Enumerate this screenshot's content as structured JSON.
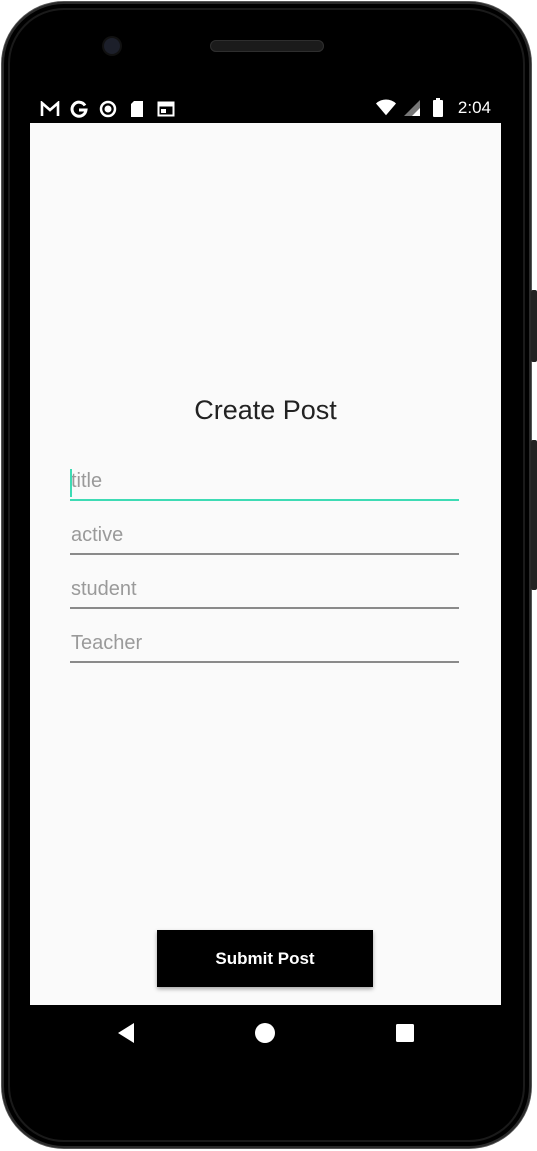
{
  "statusbar": {
    "left_icons": [
      "gmail-icon",
      "google-icon",
      "record-icon",
      "sd-card-icon",
      "calendar-icon"
    ],
    "right_icons": [
      "wifi-icon",
      "signal-icon",
      "battery-icon"
    ],
    "time": "2:04"
  },
  "main": {
    "title": "Create Post",
    "fields": [
      {
        "placeholder": "title",
        "value": "",
        "focused": true
      },
      {
        "placeholder": "active",
        "value": ""
      },
      {
        "placeholder": "student",
        "value": ""
      },
      {
        "placeholder": "Teacher",
        "value": ""
      }
    ],
    "submit_label": "Submit Post"
  },
  "navbar": {
    "icons": [
      "back-icon",
      "home-icon",
      "recents-icon"
    ]
  },
  "colors": {
    "accent": "#3ddbb4",
    "screen_bg": "#fafafa",
    "button_bg": "#000000"
  }
}
